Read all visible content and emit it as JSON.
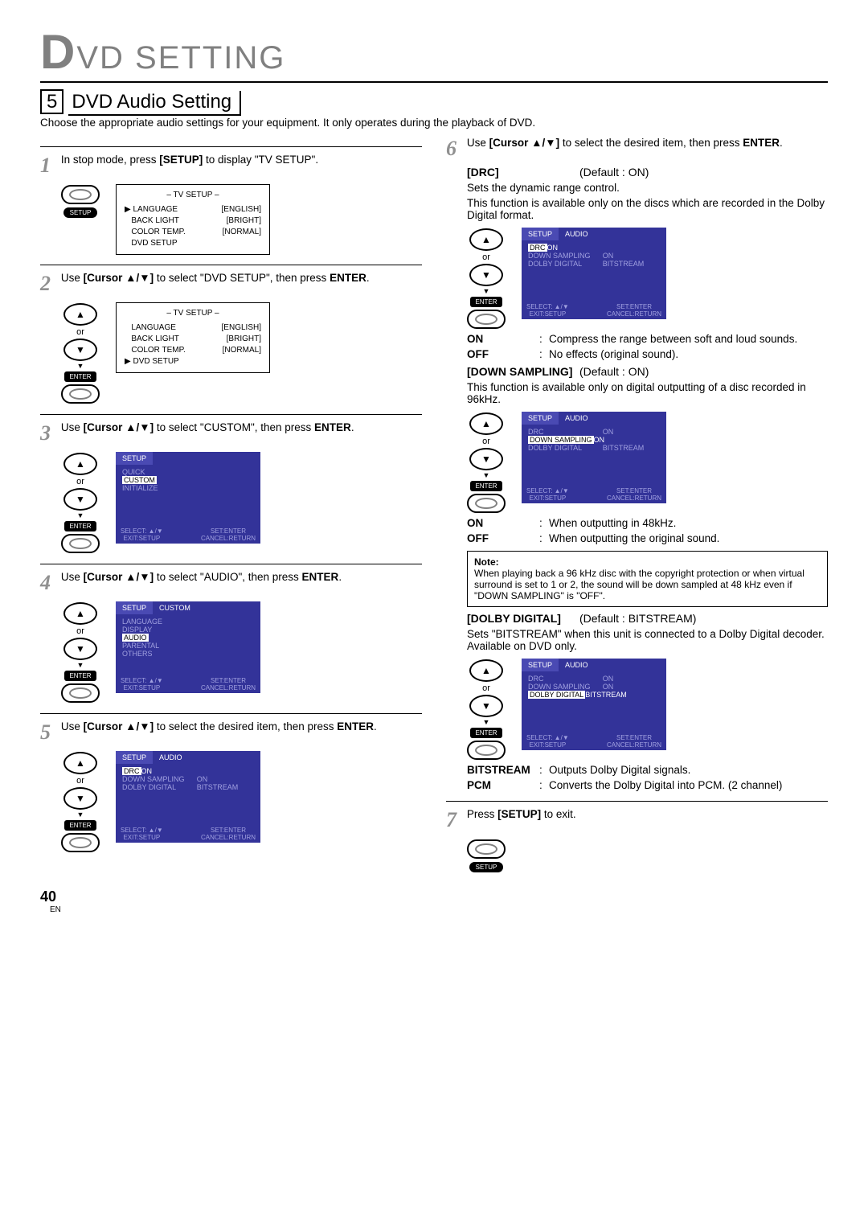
{
  "header": "VD SETTING",
  "header_prefix": "D",
  "section": {
    "num": "5",
    "title": "DVD Audio Setting"
  },
  "intro": "Choose the appropriate audio settings for your equipment. It only operates during the playback of DVD.",
  "page": {
    "num": "40",
    "lang": "EN"
  },
  "cursor_label": "[Cursor ▲/▼]",
  "setup_label": "[SETUP]",
  "enter_label": "ENTER",
  "chevron": "▶",
  "steps": {
    "s1": {
      "num": "1",
      "text_a": "In stop mode, press ",
      "text_b": " to display \"TV SETUP\".",
      "remote_btn": "SETUP",
      "menu": {
        "title": "– TV SETUP –",
        "items": [
          {
            "l": "LANGUAGE",
            "r": "[ENGLISH]",
            "sel": true
          },
          {
            "l": "BACK LIGHT",
            "r": "[BRIGHT]"
          },
          {
            "l": "COLOR TEMP.",
            "r": "[NORMAL]"
          },
          {
            "l": "DVD SETUP",
            "r": ""
          }
        ]
      }
    },
    "s2": {
      "num": "2",
      "text_a": "Use ",
      "text_b": " to select \"DVD SETUP\", then press ",
      "menu": {
        "title": "– TV SETUP –",
        "items": [
          {
            "l": "LANGUAGE",
            "r": "[ENGLISH]"
          },
          {
            "l": "BACK LIGHT",
            "r": "[BRIGHT]"
          },
          {
            "l": "COLOR TEMP.",
            "r": "[NORMAL]"
          },
          {
            "l": "DVD SETUP",
            "r": "",
            "sel": true
          }
        ]
      }
    },
    "s3": {
      "num": "3",
      "text_a": "Use ",
      "text_b": " to select \"CUSTOM\", then press ",
      "osd": {
        "tabs": [
          "SETUP"
        ],
        "rows": [
          {
            "l": "QUICK",
            "r": ""
          },
          {
            "l": "CUSTOM",
            "r": "",
            "hl": true
          },
          {
            "l": "INITIALIZE",
            "r": ""
          }
        ]
      }
    },
    "s4": {
      "num": "4",
      "text_a": "Use ",
      "text_b": " to select \"AUDIO\", then press ",
      "osd": {
        "tabs": [
          "SETUP",
          "CUSTOM"
        ],
        "rows": [
          {
            "l": "LANGUAGE",
            "r": ""
          },
          {
            "l": "DISPLAY",
            "r": ""
          },
          {
            "l": "AUDIO",
            "r": "",
            "hl": true
          },
          {
            "l": "PARENTAL",
            "r": ""
          },
          {
            "l": "OTHERS",
            "r": ""
          }
        ]
      }
    },
    "s5": {
      "num": "5",
      "text_a": "Use ",
      "text_b": " to select the desired item, then press ",
      "osd": {
        "tabs": [
          "SETUP",
          "AUDIO"
        ],
        "rows": [
          {
            "l": "DRC",
            "r": "ON",
            "hl": true
          },
          {
            "l": "DOWN SAMPLING",
            "r": "ON"
          },
          {
            "l": "DOLBY DIGITAL",
            "r": "BITSTREAM"
          }
        ]
      }
    },
    "s6": {
      "num": "6",
      "text_a": "Use ",
      "text_b": " to select the desired item, then press "
    },
    "s7": {
      "num": "7",
      "text_a": "Press ",
      "text_b": " to exit.",
      "remote_btn": "SETUP"
    }
  },
  "params": {
    "drc": {
      "name": "[DRC]",
      "default": "(Default : ON)",
      "desc1": "Sets the dynamic range control.",
      "desc2": "This function is available only on the discs which are recorded in the Dolby Digital format.",
      "osd": {
        "tabs": [
          "SETUP",
          "AUDIO"
        ],
        "rows": [
          {
            "l": "DRC",
            "r": "ON",
            "hl": true
          },
          {
            "l": "DOWN SAMPLING",
            "r": "ON"
          },
          {
            "l": "DOLBY DIGITAL",
            "r": "BITSTREAM"
          }
        ]
      },
      "opts": [
        {
          "k": "ON",
          "v": "Compress the range between soft and loud sounds."
        },
        {
          "k": "OFF",
          "v": "No effects (original sound)."
        }
      ]
    },
    "down": {
      "name": "[DOWN SAMPLING]",
      "default": "(Default : ON)",
      "desc": "This function is available only on digital outputting of a disc recorded in 96kHz.",
      "osd": {
        "tabs": [
          "SETUP",
          "AUDIO"
        ],
        "rows": [
          {
            "l": "DRC",
            "r": "ON"
          },
          {
            "l": "DOWN SAMPLING",
            "r": "ON",
            "hl": true
          },
          {
            "l": "DOLBY DIGITAL",
            "r": "BITSTREAM"
          }
        ]
      },
      "opts": [
        {
          "k": "ON",
          "v": "When outputting in 48kHz."
        },
        {
          "k": "OFF",
          "v": "When outputting the original sound."
        }
      ],
      "note_title": "Note:",
      "note": "When playing back a 96 kHz disc with the copyright protection or when virtual surround is set to 1 or 2, the sound will be down sampled at 48 kHz even if \"DOWN SAMPLING\" is \"OFF\"."
    },
    "dolby": {
      "name": "[DOLBY DIGITAL]",
      "default": "(Default : BITSTREAM)",
      "desc": "Sets \"BITSTREAM\" when this unit is connected to a Dolby Digital decoder. Available on DVD only.",
      "osd": {
        "tabs": [
          "SETUP",
          "AUDIO"
        ],
        "rows": [
          {
            "l": "DRC",
            "r": "ON"
          },
          {
            "l": "DOWN SAMPLING",
            "r": "ON"
          },
          {
            "l": "DOLBY DIGITAL",
            "r": "BITSTREAM",
            "hl": true
          }
        ]
      },
      "opts": [
        {
          "k": "BITSTREAM",
          "v": "Outputs Dolby Digital signals."
        },
        {
          "k": "PCM",
          "v": "Converts the Dolby Digital into PCM. (2 channel)"
        }
      ]
    }
  },
  "osd_footer": {
    "l1": "SELECT: ▲/▼",
    "l2": "EXIT:SETUP",
    "r1": "SET:ENTER",
    "r2": "CANCEL:RETURN"
  },
  "remote": {
    "or": "or",
    "enter": "ENTER",
    "setup": "SETUP"
  }
}
